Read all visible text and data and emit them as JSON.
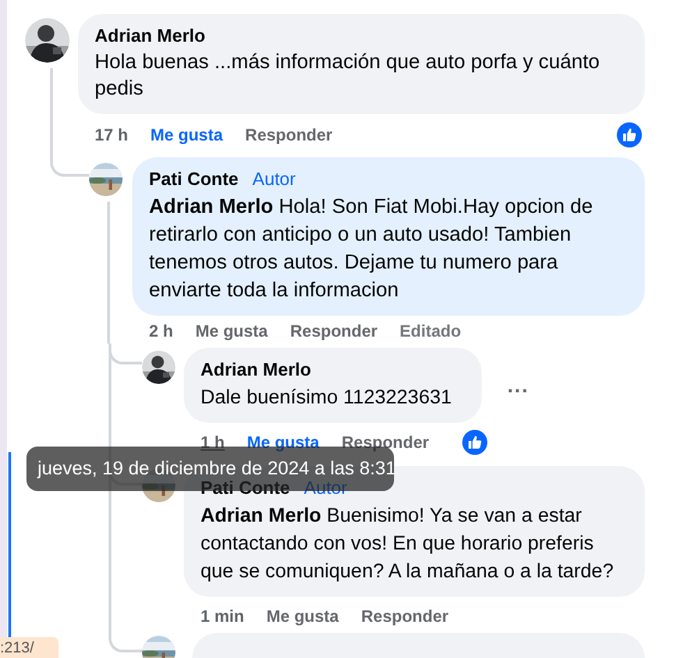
{
  "comments": [
    {
      "kind": "full",
      "author": "Adrian Merlo",
      "text": "Hola buenas ...más información que auto porfa y cuánto pedis",
      "highlighted": false,
      "actions": [
        {
          "kind": "time",
          "label": "17 h",
          "hovered": false
        },
        {
          "kind": "like",
          "label": "Me gusta",
          "selected": true
        },
        {
          "kind": "reply",
          "label": "Responder"
        }
      ],
      "has_reaction": true,
      "replies": [
        {
          "kind": "full",
          "author": "Pati Conte",
          "author_badge": "Autor",
          "text": "**Adrian Merlo** Hola! Son Fiat Mobi.Hay opcion de retirarlo con anticipo o un auto usado! Tambien tenemos otros autos. Dejame tu numero para enviarte toda la informacion",
          "highlighted": true,
          "actions": [
            {
              "kind": "time",
              "label": "2 h",
              "hovered": false
            },
            {
              "kind": "like",
              "label": "Me gusta",
              "selected": false
            },
            {
              "kind": "reply",
              "label": "Responder"
            },
            {
              "kind": "edited",
              "label": "Editado"
            }
          ],
          "replies": [
            {
              "kind": "full",
              "author": "Adrian Merlo",
              "text": "Dale buenísimo 1123223631",
              "highlighted": false,
              "more": "...",
              "actions": [
                {
                  "kind": "time",
                  "label": "1 h",
                  "hovered": true
                },
                {
                  "kind": "like",
                  "label": "Me gusta",
                  "selected": true
                },
                {
                  "kind": "reply",
                  "label": "Responder"
                }
              ],
              "has_reaction": true
            },
            {
              "kind": "full",
              "author": "Pati Conte",
              "author_badge": "Autor",
              "text": "**Adrian Merlo** Buenisimo! Ya se van a estar contactando con vos! En que horario preferis que se comuniquen? A la mañana o a la tarde?",
              "highlighted": false,
              "actions": [
                {
                  "kind": "time",
                  "label": "1 min",
                  "hovered": false
                },
                {
                  "kind": "like",
                  "label": "Me gusta",
                  "selected": false
                },
                {
                  "kind": "reply",
                  "label": "Responder"
                }
              ]
            },
            {
              "kind": "cut_off"
            }
          ]
        }
      ]
    }
  ],
  "tooltip": {
    "text": "jueves, 19 de diciembre de 2024 a las 8:31"
  },
  "edge_tag": {
    "text": ":213/"
  }
}
